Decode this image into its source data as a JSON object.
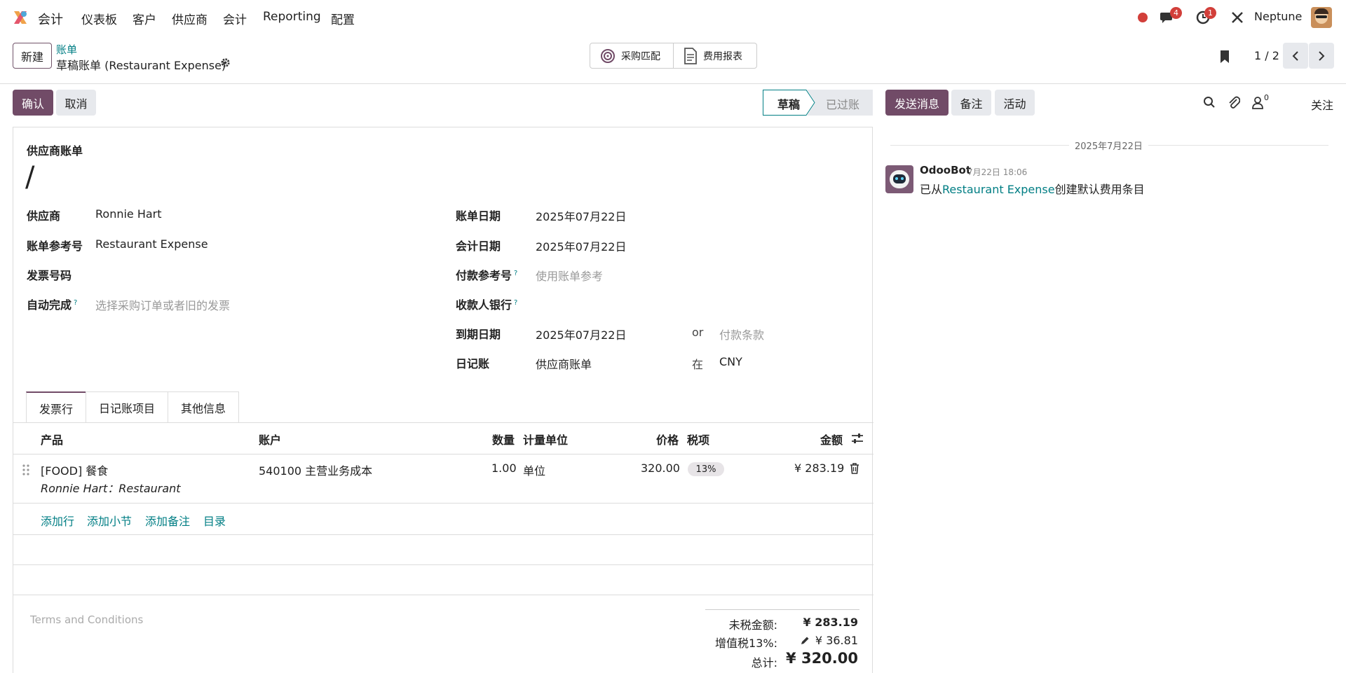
{
  "navbar": {
    "app_name": "会计",
    "menu": [
      "仪表板",
      "客户",
      "供应商",
      "会计",
      "Reporting",
      "配置"
    ],
    "messages_count": "4",
    "activities_count": "1",
    "user_name": "Neptune",
    "colors": {
      "status_dot": "#d23f3a",
      "badge": "#d23f3a"
    }
  },
  "control": {
    "new_label": "新建",
    "breadcrumb_parent": "账单",
    "breadcrumb_current": "草稿账单 (Restaurant Expense)",
    "smart_buttons": [
      "采购匹配",
      "费用报表"
    ],
    "pager": "1 / 2"
  },
  "actions": {
    "confirm": "确认",
    "cancel": "取消",
    "status_current": "草稿",
    "status_next": "已过账",
    "send_message": "发送消息",
    "log_note": "备注",
    "activity": "活动",
    "followers_count": "0",
    "follow": "关注"
  },
  "form": {
    "doc_type": "供应商账单",
    "doc_number": "/",
    "left": [
      {
        "label": "供应商",
        "value": "Ronnie Hart",
        "placeholder": "",
        "help": ""
      },
      {
        "label": "账单参考号",
        "value": "Restaurant Expense",
        "placeholder": "",
        "help": ""
      },
      {
        "label": "发票号码",
        "value": "",
        "placeholder": "",
        "help": ""
      },
      {
        "label": "自动完成",
        "value": "",
        "placeholder": "选择采购订单或者旧的发票",
        "help": "?"
      }
    ],
    "right": [
      {
        "label": "账单日期",
        "value": "2025年07月22日",
        "placeholder": "",
        "help": ""
      },
      {
        "label": "会计日期",
        "value": "2025年07月22日",
        "placeholder": "",
        "help": ""
      },
      {
        "label": "付款参考号",
        "value": "",
        "placeholder": "使用账单参考",
        "help": "?"
      },
      {
        "label": "收款人银行",
        "value": "",
        "placeholder": "",
        "help": "?"
      },
      {
        "label": "到期日期",
        "value": "2025年07月22日",
        "placeholder": "",
        "help": ""
      },
      {
        "label": "日记账",
        "value": "供应商账单",
        "placeholder": "",
        "help": ""
      }
    ],
    "due_or": "or",
    "payment_terms_placeholder": "付款条款",
    "journal_in": "在",
    "currency": "CNY"
  },
  "tabs": [
    "发票行",
    "日记账项目",
    "其他信息"
  ],
  "table": {
    "headers": {
      "product": "产品",
      "account": "账户",
      "qty": "数量",
      "uom": "计量单位",
      "price": "价格",
      "tax": "税项",
      "amount": "金额"
    },
    "rows": [
      {
        "product": "[FOOD] 餐食",
        "description": "Ronnie Hart：Restaurant",
        "account": "540100 主营业务成本",
        "qty": "1.00",
        "uom": "单位",
        "price": "320.00",
        "tax": "13%",
        "amount": "¥ 283.19"
      }
    ],
    "add_links": [
      "添加行",
      "添加小节",
      "添加备注",
      "目录"
    ]
  },
  "footer": {
    "terms_placeholder": "Terms and Conditions",
    "untaxed_label": "未税金额:",
    "untaxed_value": "¥ 283.19",
    "tax_label": "增值税13%:",
    "tax_value": "¥ 36.81",
    "total_label": "总计:",
    "total_value": "¥ 320.00"
  },
  "chatter": {
    "date_separator": "2025年7月22日",
    "messages": [
      {
        "author": "OdooBot",
        "time": "7月22日 18:06",
        "prefix": "已从",
        "link": "Restaurant Expense",
        "suffix": "创建默认费用条目"
      }
    ]
  }
}
